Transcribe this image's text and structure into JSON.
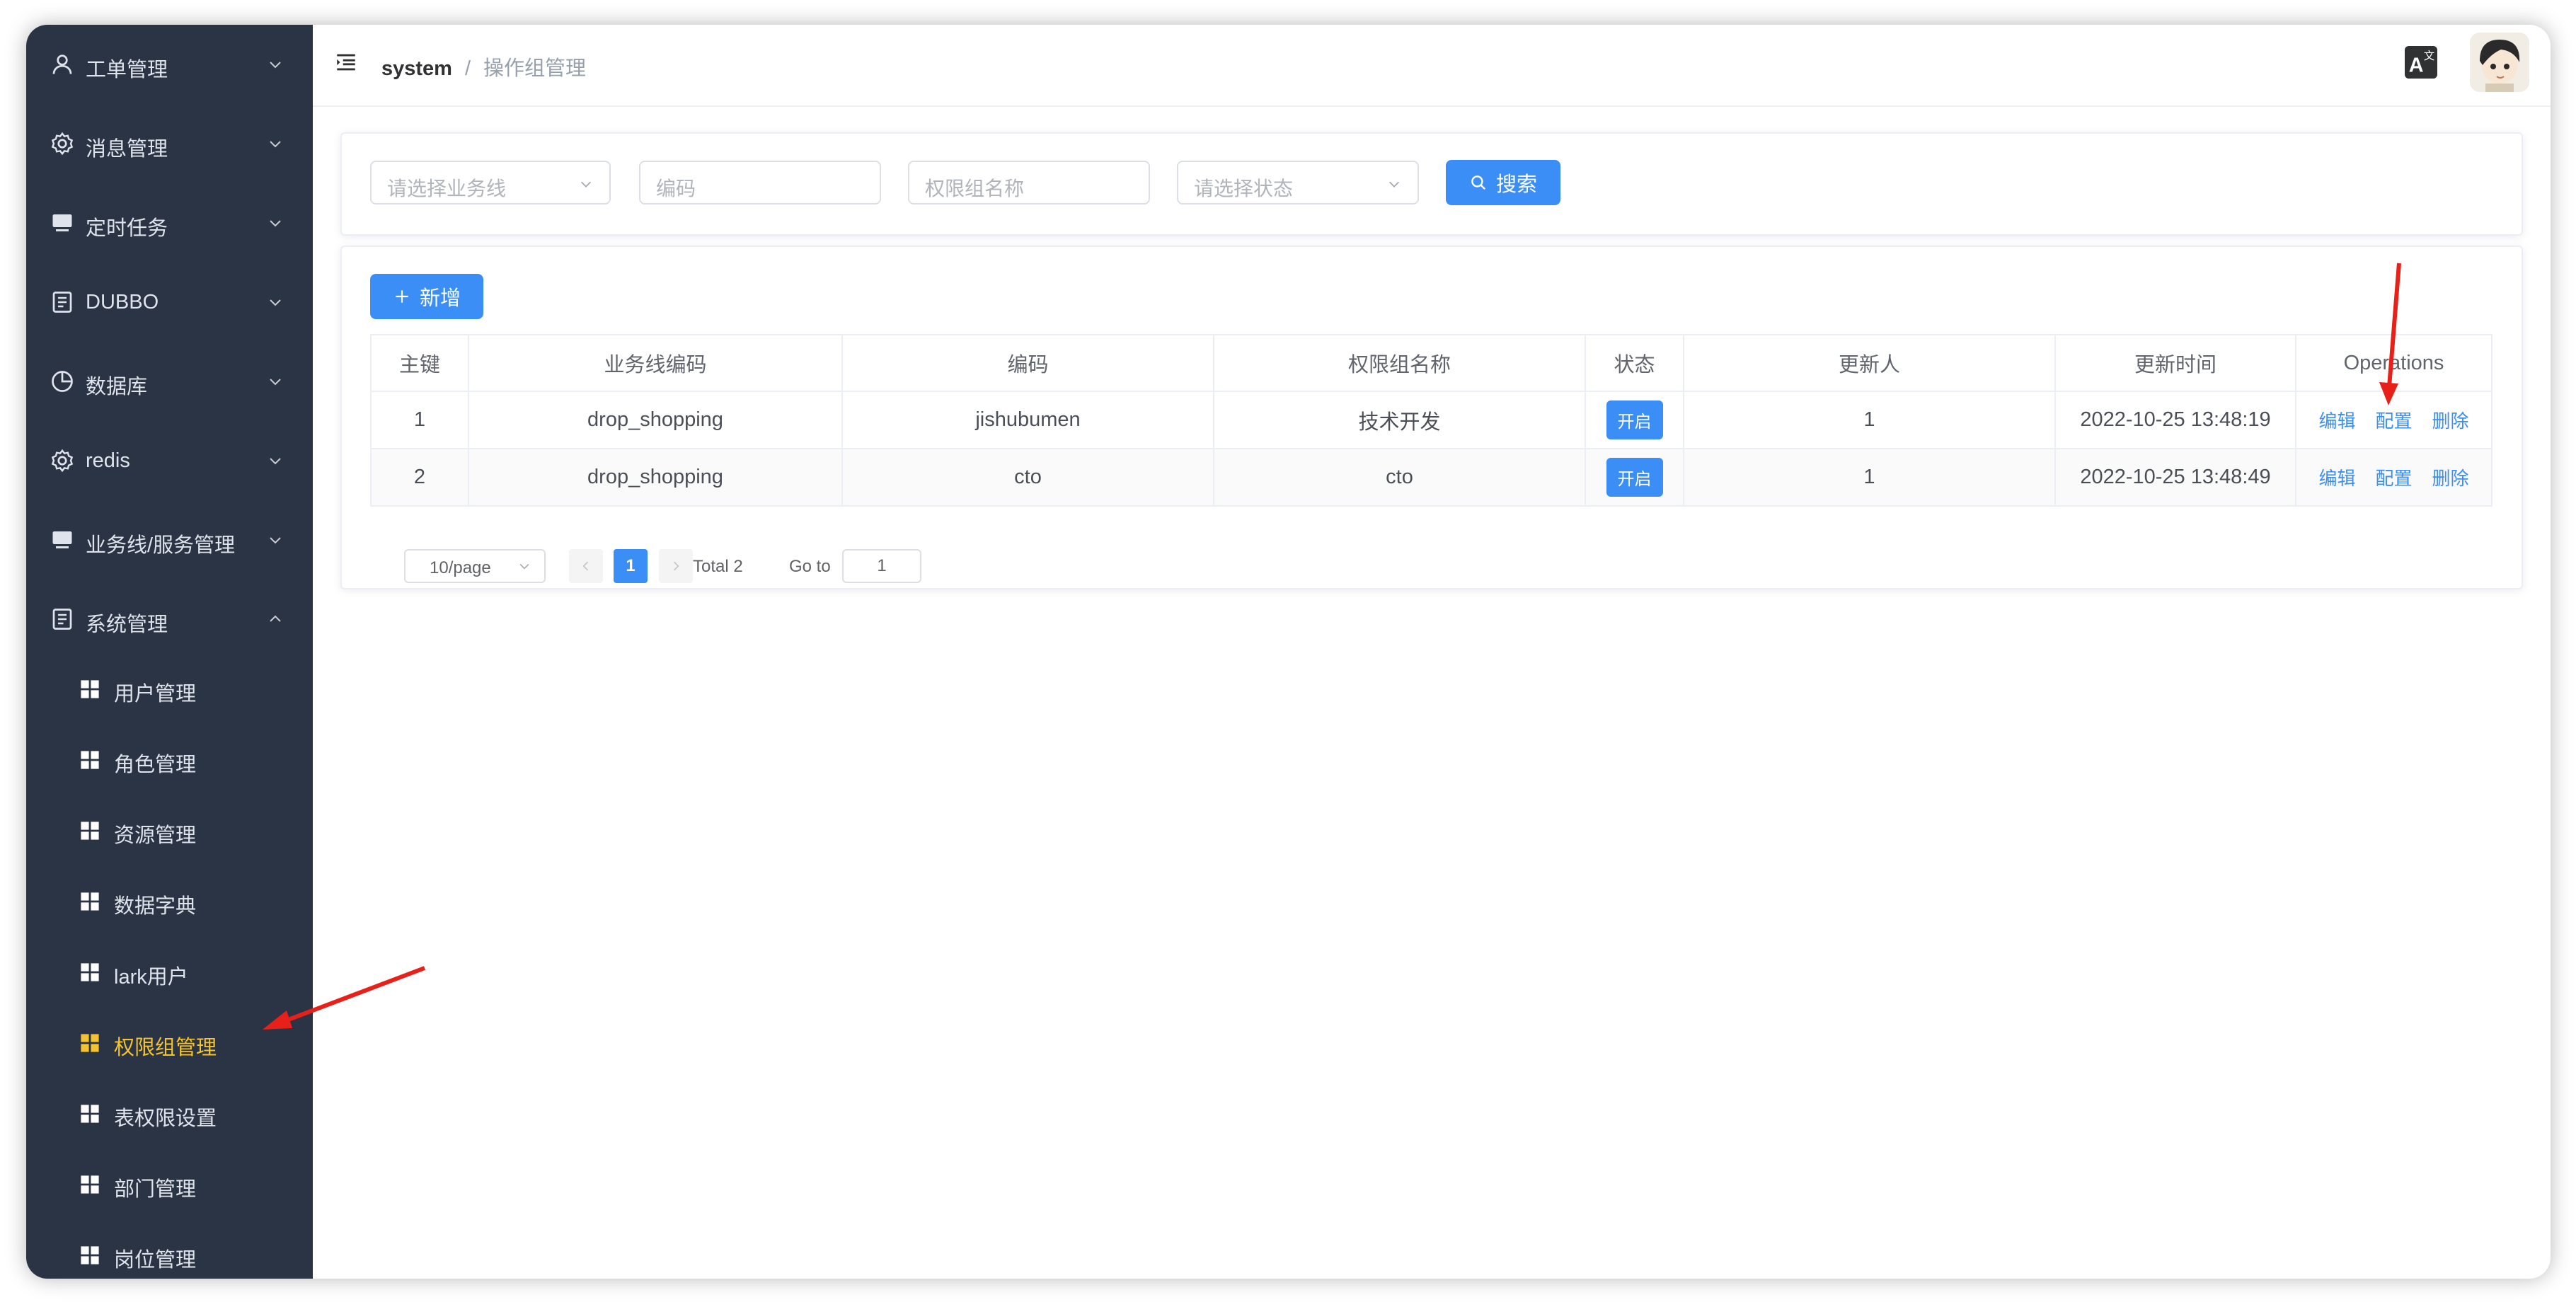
{
  "sidebar": {
    "menu": [
      {
        "label": "工单管理",
        "icon": "user-icon"
      },
      {
        "label": "消息管理",
        "icon": "gear-icon"
      },
      {
        "label": "定时任务",
        "icon": "monitor-icon"
      },
      {
        "label": "DUBBO",
        "icon": "document-icon"
      },
      {
        "label": "数据库",
        "icon": "pie-chart-icon"
      },
      {
        "label": "redis",
        "icon": "gear-icon"
      },
      {
        "label": "业务线/服务管理",
        "icon": "monitor-icon"
      },
      {
        "label": "系统管理",
        "icon": "document-icon"
      }
    ],
    "submenu": [
      {
        "label": "用户管理"
      },
      {
        "label": "角色管理"
      },
      {
        "label": "资源管理"
      },
      {
        "label": "数据字典"
      },
      {
        "label": "lark用户"
      },
      {
        "label": "权限组管理",
        "active": true
      },
      {
        "label": "表权限设置"
      },
      {
        "label": "部门管理"
      },
      {
        "label": "岗位管理"
      }
    ]
  },
  "header": {
    "breadcrumb_root": "system",
    "breadcrumb_separator": "/",
    "breadcrumb_current": "操作组管理"
  },
  "filters": {
    "business_line_placeholder": "请选择业务线",
    "code_placeholder": "编码",
    "group_name_placeholder": "权限组名称",
    "status_placeholder": "请选择状态",
    "search_label": "搜索"
  },
  "toolbar": {
    "add_label": "新增"
  },
  "table": {
    "columns": [
      "主键",
      "业务线编码",
      "编码",
      "权限组名称",
      "状态",
      "更新人",
      "更新时间",
      "Operations"
    ],
    "rows": [
      {
        "id": "1",
        "business_code": "drop_shopping",
        "code": "jishubumen",
        "name": "技术开发",
        "status": "开启",
        "updater": "1",
        "updated_at": "2022-10-25 13:48:19"
      },
      {
        "id": "2",
        "business_code": "drop_shopping",
        "code": "cto",
        "name": "cto",
        "status": "开启",
        "updater": "1",
        "updated_at": "2022-10-25 13:48:49"
      }
    ],
    "ops": {
      "edit": "编辑",
      "config": "配置",
      "delete": "删除"
    }
  },
  "pagination": {
    "page_size": "10/page",
    "current_page": "1",
    "total": "Total 2",
    "goto_label": "Go to",
    "goto_value": "1"
  },
  "colors": {
    "sidebar_bg": "#2b3445",
    "primary": "#3a8ef6",
    "active_menu": "#f4c430",
    "annotation_arrow": "#e8201a"
  }
}
